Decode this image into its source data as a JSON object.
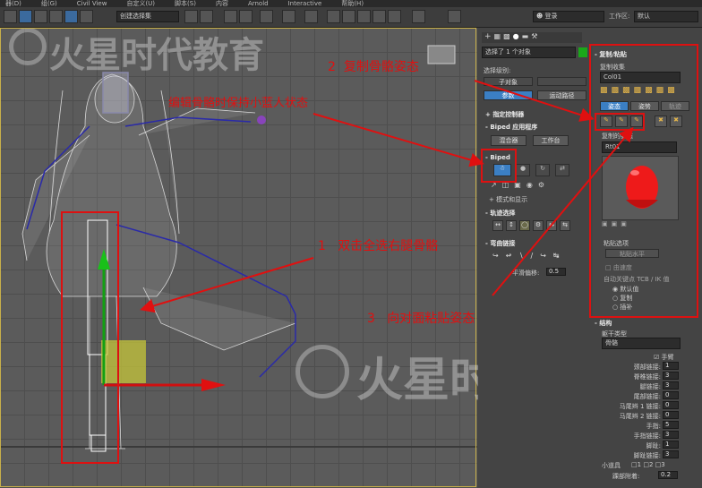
{
  "menu": [
    "器(D)",
    "组(G)",
    "Civil View",
    "自定义(U)",
    "脚本(S)",
    "内容",
    "Arnold",
    "Interactive",
    "帮助(H)"
  ],
  "toolbar": {
    "selection_set": "创建选择集",
    "search_placeholder": "登录",
    "workspace_label": "工作区:",
    "workspace_value": "默认"
  },
  "watermark": {
    "text": "火星时代教育"
  },
  "command_panel": {
    "object_name": "选择了 1 个对象",
    "selection_level": "选择级别:",
    "sub_object": "子对象",
    "tab_params": "参数",
    "tab_motion_paths": "运动路径",
    "assign_controller": "指定控制器",
    "biped_apps": "Biped 应用程序",
    "mixer": "混合器",
    "workbench": "工作台",
    "biped": "Biped",
    "modes_display": "模式和显示",
    "track_selection": "轨迹选择",
    "bend_links": "弯曲链接",
    "smoothing_label": "平滑偏移:",
    "smoothing_value": "0.5"
  },
  "copy_paste": {
    "title": "复制/粘贴",
    "collections_label": "复制收集",
    "collection_value": "Col01",
    "tabs": [
      "姿态",
      "姿势",
      "轨迹"
    ],
    "copied_poses_label": "复制的姿态",
    "pose_value": "Rt01",
    "paste_options": "粘贴选项",
    "paste_horizontal": "粘贴水平",
    "paste_vertical": "由速度",
    "auto_key_label": "自动关键点 TCB / IK 值",
    "radio_default": "默认值",
    "radio_copy": "复制",
    "radio_interp": "插补"
  },
  "structure": {
    "title": "结构",
    "trunk_type_label": "躯干类型",
    "trunk_type_value": "骨骼",
    "hands_label": "手臂",
    "rows": [
      {
        "label": "颈部链接:",
        "value": "1"
      },
      {
        "label": "脊椎链接:",
        "value": "3"
      },
      {
        "label": "腿链接:",
        "value": "3"
      },
      {
        "label": "尾部链接:",
        "value": "0"
      },
      {
        "label": "马尾辫 1 链接:",
        "value": "0"
      },
      {
        "label": "马尾辫 2 链接:",
        "value": "0"
      },
      {
        "label": "手指:",
        "value": "5"
      },
      {
        "label": "手指链接:",
        "value": "3"
      },
      {
        "label": "脚趾:",
        "value": "1"
      },
      {
        "label": "脚趾链接:",
        "value": "3"
      }
    ],
    "props_label": "小道具",
    "props": [
      "1",
      "2",
      "3"
    ],
    "ankle_label": "踝部附着:",
    "ankle_value": "0.2"
  },
  "annotations": {
    "a1_num": "1",
    "a1_text": "双击全选右腿骨骼",
    "a2_num": "2",
    "a2_text": "复制骨骼姿态",
    "a3_num": "3",
    "a3_text": "向对面粘贴姿态",
    "edit_note": "编辑骨骼时保持小蓝人状态"
  }
}
